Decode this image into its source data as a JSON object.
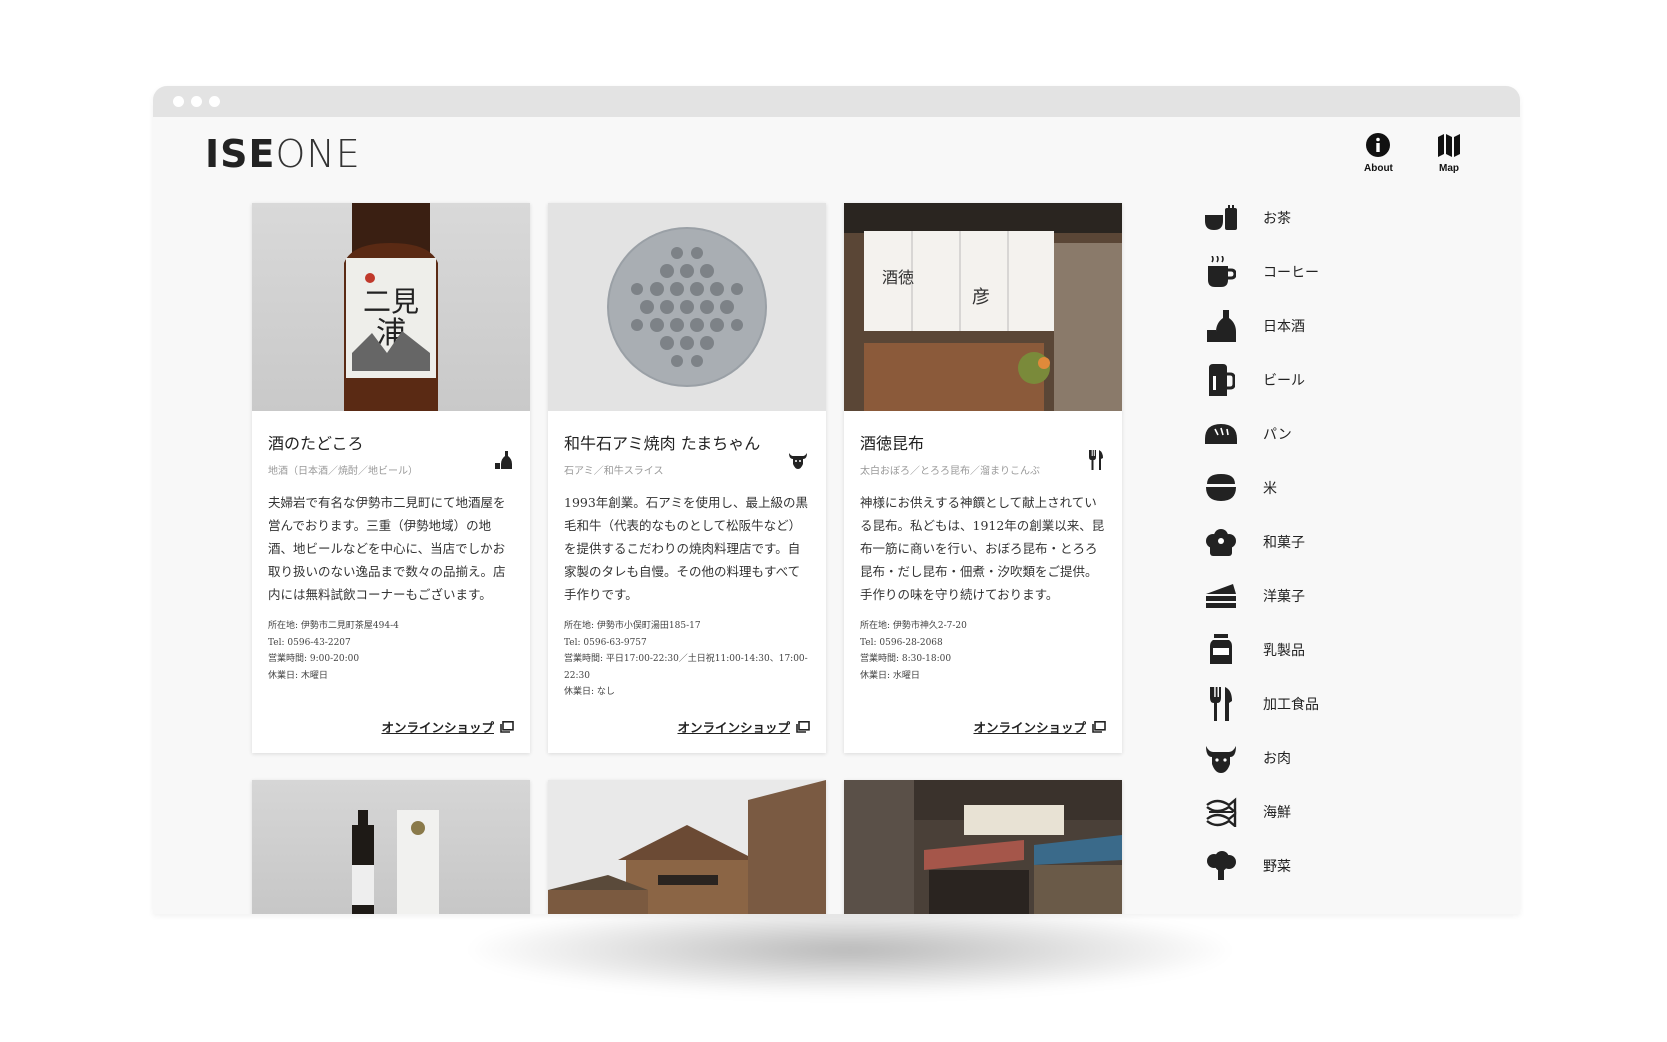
{
  "brand": {
    "logo_bold": "ISE",
    "logo_light": "ONE"
  },
  "topnav": [
    {
      "label": "About",
      "icon": "info-icon"
    },
    {
      "label": "Map",
      "icon": "map-icon"
    }
  ],
  "cards": [
    {
      "title": "酒のたどころ",
      "icon": "sake-bottle-icon",
      "subtitle": "地酒（日本酒／焼酎／地ビール）",
      "description": "夫婦岩で有名な伊勢市二見町にて地酒屋を営んでおります。三重（伊勢地域）の地酒、地ビールなどを中心に、当店でしかお取り扱いのない逸品まで数々の品揃え。店内には無料試飲コーナーもございます。",
      "address": "所在地: 伊勢市二見町茶屋494-4",
      "tel": "Tel: 0596-43-2207",
      "hours": "営業時間: 9:00-20:00",
      "closed": "休業日: 木曜日",
      "shop_label": "オンラインショップ"
    },
    {
      "title": "和牛石アミ焼肉 たまちゃん",
      "icon": "cow-icon",
      "subtitle": "石アミ／和牛スライス",
      "description": "1993年創業。石アミを使用し、最上級の黒毛和牛（代表的なものとして松阪牛など）を提供するこだわりの焼肉料理店です。自家製のタレも自慢。その他の料理もすべて手作りです。",
      "address": "所在地: 伊勢市小俣町湯田185-17",
      "tel": "Tel: 0596-63-9757",
      "hours": "営業時間: 平日17:00-22:30／土日祝11:00-14:30、17:00-22:30",
      "closed": "休業日: なし",
      "shop_label": "オンラインショップ"
    },
    {
      "title": "酒徳昆布",
      "icon": "fork-knife-icon",
      "subtitle": "太白おぼろ／とろろ昆布／溜まりこんぶ",
      "description": "神様にお供えする神饌として献上されている昆布。私どもは、1912年の創業以来、昆布一筋に商いを行い、おぼろ昆布・とろろ昆布・だし昆布・佃煮・汐吹類をご提供。手作りの味を守り続けております。",
      "address": "所在地: 伊勢市神久2-7-20",
      "tel": "Tel: 0596-28-2068",
      "hours": "営業時間: 8:30-18:00",
      "closed": "休業日: 水曜日",
      "shop_label": "オンラインショップ"
    }
  ],
  "categories": [
    {
      "label": "お茶",
      "icon": "tea-icon"
    },
    {
      "label": "コーヒー",
      "icon": "coffee-icon"
    },
    {
      "label": "日本酒",
      "icon": "sake-icon"
    },
    {
      "label": "ビール",
      "icon": "beer-icon"
    },
    {
      "label": "パン",
      "icon": "bread-icon"
    },
    {
      "label": "米",
      "icon": "rice-icon"
    },
    {
      "label": "和菓子",
      "icon": "wagashi-icon"
    },
    {
      "label": "洋菓子",
      "icon": "cake-icon"
    },
    {
      "label": "乳製品",
      "icon": "milk-icon"
    },
    {
      "label": "加工食品",
      "icon": "fork-knife-icon"
    },
    {
      "label": "お肉",
      "icon": "cow-icon"
    },
    {
      "label": "海鮮",
      "icon": "fish-icon"
    },
    {
      "label": "野菜",
      "icon": "broccoli-icon"
    }
  ]
}
